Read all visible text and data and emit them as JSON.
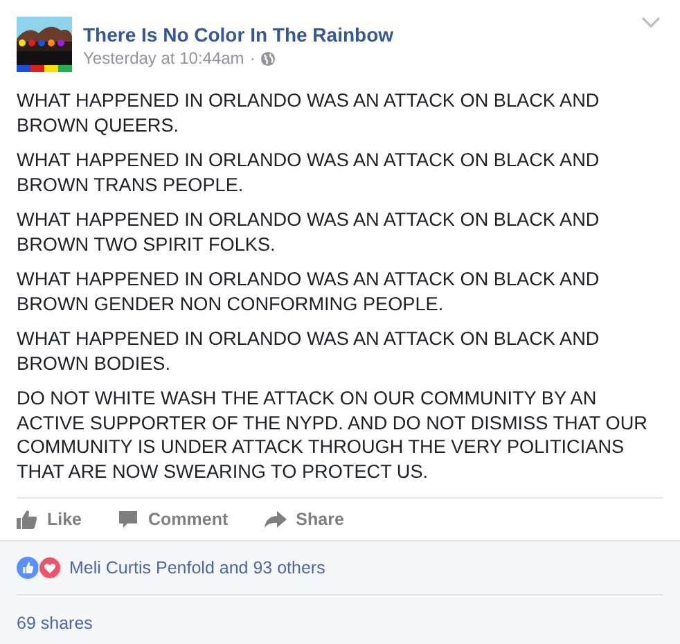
{
  "post": {
    "page_name": "There Is No Color In The Rainbow",
    "timestamp": "Yesterday at 10:44am",
    "separator": "·",
    "paragraphs": [
      "WHAT HAPPENED IN ORLANDO WAS AN ATTACK ON BLACK AND BROWN QUEERS.",
      "WHAT HAPPENED IN ORLANDO WAS AN ATTACK ON BLACK AND BROWN TRANS PEOPLE.",
      "WHAT HAPPENED IN ORLANDO WAS AN ATTACK ON BLACK AND BROWN TWO SPIRIT FOLKS.",
      "WHAT HAPPENED IN ORLANDO WAS AN ATTACK ON BLACK AND BROWN GENDER NON CONFORMING PEOPLE.",
      "WHAT HAPPENED IN ORLANDO WAS AN ATTACK ON BLACK AND BROWN BODIES.",
      "DO NOT WHITE WASH THE ATTACK ON OUR COMMUNITY BY AN ACTIVE SUPPORTER OF THE NYPD. AND DO NOT DISMISS THAT OUR COMMUNITY IS UNDER ATTACK THROUGH THE VERY POLITICIANS THAT ARE NOW SWEARING TO PROTECT US."
    ],
    "actions": [
      {
        "kind": "like",
        "label": "Like"
      },
      {
        "kind": "comment",
        "label": "Comment"
      },
      {
        "kind": "share",
        "label": "Share"
      }
    ],
    "reactions": {
      "summary": "Meli Curtis Penfold and 93 others"
    },
    "shares": "69 shares"
  }
}
